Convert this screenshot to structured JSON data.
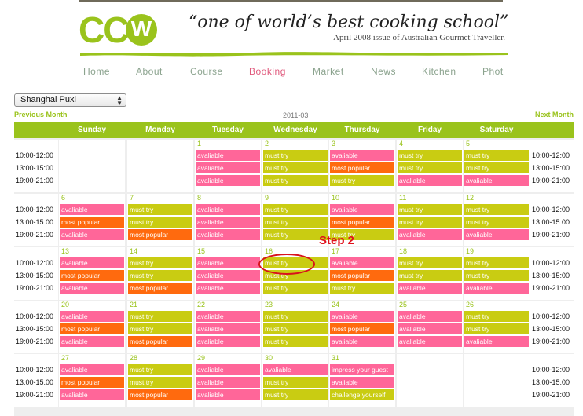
{
  "header": {
    "logo_letters": "CC",
    "logo_badge": "W",
    "slogan": "“one of world’s best cooking school”",
    "slogan_source": "April 2008 issue of Australian Gourmet Traveller."
  },
  "nav": {
    "items": [
      "Home",
      "About",
      "Course",
      "Booking",
      "Market",
      "News",
      "Kitchen",
      "Phot"
    ],
    "active": "Booking"
  },
  "controls": {
    "location": "Shanghai Puxi",
    "prev_month": "Previous Month",
    "next_month": "Next Month",
    "month": "2011-03"
  },
  "calendar": {
    "weekdays": [
      "Sunday",
      "Monday",
      "Tuesday",
      "Wednesday",
      "Thursday",
      "Friday",
      "Saturday"
    ],
    "times": [
      "10:00-12:00",
      "13:00-15:00",
      "19:00-21:00"
    ],
    "weeks": [
      [
        null,
        null,
        {
          "date": "1",
          "slots": [
            "avaliable",
            "avaliable",
            "avaliable"
          ]
        },
        {
          "date": "2",
          "slots": [
            "must try",
            "must try",
            "must try"
          ]
        },
        {
          "date": "3",
          "slots": [
            "avaliable",
            "most popular",
            "must try"
          ]
        },
        {
          "date": "4",
          "slots": [
            "must try",
            "must try",
            "avaliable"
          ]
        },
        {
          "date": "5",
          "slots": [
            "must try",
            "must try",
            "avaliable"
          ]
        }
      ],
      [
        {
          "date": "6",
          "slots": [
            "avaliable",
            "most popular",
            "avaliable"
          ]
        },
        {
          "date": "7",
          "slots": [
            "must try",
            "must try",
            "most popular"
          ]
        },
        {
          "date": "8",
          "slots": [
            "avaliable",
            "avaliable",
            "avaliable"
          ]
        },
        {
          "date": "9",
          "slots": [
            "must try",
            "must try",
            "must try"
          ]
        },
        {
          "date": "10",
          "slots": [
            "avaliable",
            "most popular",
            "must try"
          ]
        },
        {
          "date": "11",
          "slots": [
            "must try",
            "must try",
            "avaliable"
          ]
        },
        {
          "date": "12",
          "slots": [
            "must try",
            "must try",
            "avaliable"
          ]
        }
      ],
      [
        {
          "date": "13",
          "slots": [
            "avaliable",
            "most popular",
            "avaliable"
          ]
        },
        {
          "date": "14",
          "slots": [
            "must try",
            "must try",
            "most popular"
          ]
        },
        {
          "date": "15",
          "slots": [
            "avaliable",
            "avaliable",
            "avaliable"
          ]
        },
        {
          "date": "16",
          "slots": [
            "must try",
            "must try",
            "must try"
          ]
        },
        {
          "date": "17",
          "slots": [
            "avaliable",
            "most popular",
            "must try"
          ]
        },
        {
          "date": "18",
          "slots": [
            "must try",
            "must try",
            "avaliable"
          ]
        },
        {
          "date": "19",
          "slots": [
            "must try",
            "must try",
            "avaliable"
          ]
        }
      ],
      [
        {
          "date": "20",
          "slots": [
            "avaliable",
            "most popular",
            "avaliable"
          ]
        },
        {
          "date": "21",
          "slots": [
            "must try",
            "must try",
            "most popular"
          ]
        },
        {
          "date": "22",
          "slots": [
            "avaliable",
            "avaliable",
            "avaliable"
          ]
        },
        {
          "date": "23",
          "slots": [
            "must try",
            "must try",
            "must try"
          ]
        },
        {
          "date": "24",
          "slots": [
            "avaliable",
            "most popular",
            "avaliable"
          ]
        },
        {
          "date": "25",
          "slots": [
            "avaliable",
            "avaliable",
            "avaliable"
          ]
        },
        {
          "date": "26",
          "slots": [
            "must try",
            "must try",
            "avaliable"
          ]
        }
      ],
      [
        {
          "date": "27",
          "slots": [
            "avaliable",
            "most popular",
            "avaliable"
          ]
        },
        {
          "date": "28",
          "slots": [
            "must try",
            "must try",
            "most popular"
          ]
        },
        {
          "date": "29",
          "slots": [
            "avaliable",
            "avaliable",
            "avaliable"
          ]
        },
        {
          "date": "30",
          "slots": [
            "avaliable",
            "must try",
            "must try"
          ]
        },
        {
          "date": "31",
          "slots": [
            "impress your guest",
            "avaliable",
            "challenge yourself"
          ]
        },
        null,
        null
      ]
    ],
    "slot_colors": {
      "avaliable": "#ff6699",
      "must try": "#c9cc12",
      "most popular": "#ff6a0e",
      "impress your guest": "#ff6699",
      "challenge yourself": "#c9cc12"
    }
  },
  "annotation": {
    "label": "Step 2",
    "color": "#e0111c"
  },
  "colors": {
    "brand_green": "#9ac31c",
    "nav_text": "#8ba38e",
    "nav_active": "#e05a7d"
  }
}
